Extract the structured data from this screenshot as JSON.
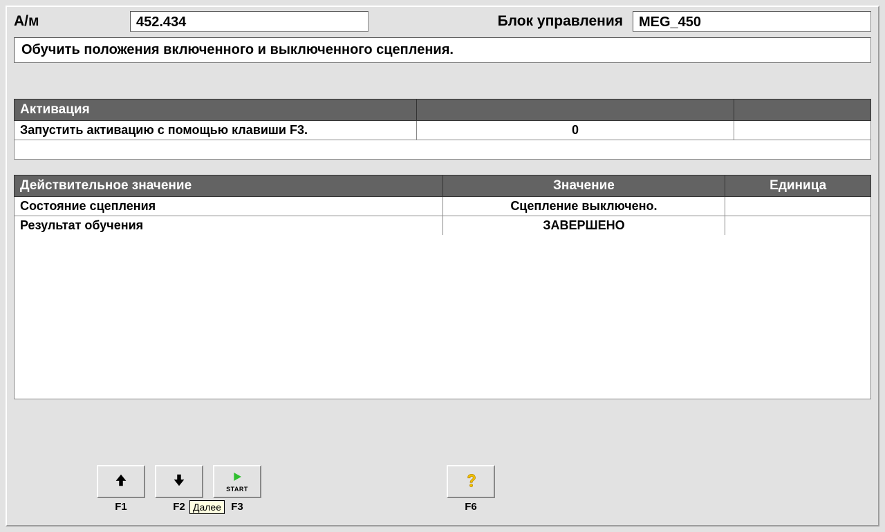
{
  "header": {
    "vehicle_label": "А/м",
    "vehicle_value": "452.434",
    "ecu_label": "Блок управления",
    "ecu_value": "MEG_450"
  },
  "title": "Обучить положения включенного и выключенного сцепления.",
  "activation_table": {
    "headers": [
      "Активация",
      "",
      ""
    ],
    "row": {
      "label": "Запустить активацию с помощью клавиши F3.",
      "value": "0",
      "unit": ""
    }
  },
  "values_table": {
    "headers": [
      "Действительное значение",
      "Значение",
      "Единица"
    ],
    "rows": [
      {
        "label": "Состояние сцепления",
        "value": "Сцепление выключено.",
        "unit": ""
      },
      {
        "label": "Результат обучения",
        "value": "ЗАВЕРШЕНО",
        "unit": ""
      }
    ]
  },
  "fkeys": {
    "f1": "F1",
    "f2": "F2",
    "f3": "F3",
    "f6": "F6",
    "start_text": "START",
    "tooltip": "Далее"
  }
}
